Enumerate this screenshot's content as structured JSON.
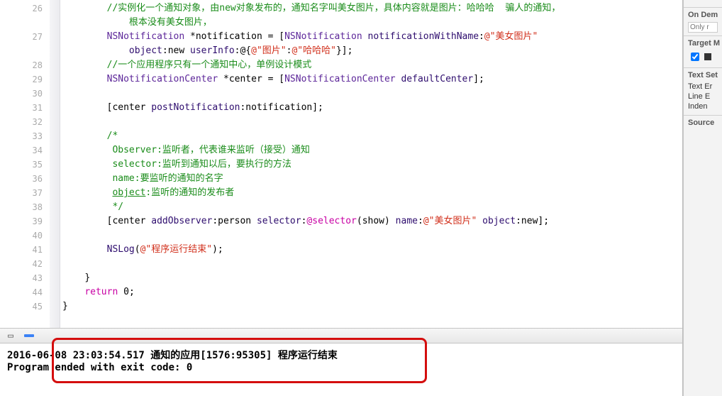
{
  "code": {
    "lines": [
      {
        "n": 26,
        "indent": "        ",
        "tokens": [
          {
            "t": "//实例化一个通知对象，由new对象发布的，通知名字叫美女图片，具体内容就是图片：哈哈哈  骗人的通知，",
            "cls": "c-comment"
          }
        ]
      },
      {
        "n": "",
        "indent": "            ",
        "tokens": [
          {
            "t": "根本没有美女图片，",
            "cls": "c-comment"
          }
        ]
      },
      {
        "n": 27,
        "indent": "        ",
        "tokens": [
          {
            "t": "NSNotification",
            "cls": "c-type"
          },
          {
            "t": " *notification = ["
          },
          {
            "t": "NSNotification",
            "cls": "c-type"
          },
          {
            "t": " "
          },
          {
            "t": "notificationWithName",
            "cls": "c-method"
          },
          {
            "t": ":"
          },
          {
            "t": "@\"美女图片\"",
            "cls": "c-string"
          }
        ]
      },
      {
        "n": "",
        "indent": "            ",
        "tokens": [
          {
            "t": "object",
            "cls": "c-method"
          },
          {
            "t": ":new "
          },
          {
            "t": "userInfo",
            "cls": "c-method"
          },
          {
            "t": ":@{"
          },
          {
            "t": "@\"图片\"",
            "cls": "c-string"
          },
          {
            "t": ":"
          },
          {
            "t": "@\"哈哈哈\"",
            "cls": "c-string"
          },
          {
            "t": "}];"
          }
        ]
      },
      {
        "n": 28,
        "indent": "        ",
        "tokens": [
          {
            "t": "//一个应用程序只有一个通知中心，单例设计模式",
            "cls": "c-comment"
          }
        ]
      },
      {
        "n": 29,
        "indent": "        ",
        "tokens": [
          {
            "t": "NSNotificationCenter",
            "cls": "c-type"
          },
          {
            "t": " *center = ["
          },
          {
            "t": "NSNotificationCenter",
            "cls": "c-type"
          },
          {
            "t": " "
          },
          {
            "t": "defaultCenter",
            "cls": "c-method"
          },
          {
            "t": "];"
          }
        ]
      },
      {
        "n": 30,
        "indent": "        ",
        "tokens": []
      },
      {
        "n": 31,
        "indent": "        ",
        "tokens": [
          {
            "t": "[center "
          },
          {
            "t": "postNotification",
            "cls": "c-method"
          },
          {
            "t": ":notification];"
          }
        ]
      },
      {
        "n": 32,
        "indent": "        ",
        "tokens": []
      },
      {
        "n": 33,
        "indent": "        ",
        "tokens": [
          {
            "t": "/*",
            "cls": "c-comment"
          }
        ]
      },
      {
        "n": 34,
        "indent": "         ",
        "tokens": [
          {
            "t": "Observer:监听者，代表谁来监听（接受）通知",
            "cls": "c-comment"
          }
        ]
      },
      {
        "n": 35,
        "indent": "         ",
        "tokens": [
          {
            "t": "selector:监听到通知以后，要执行的方法",
            "cls": "c-comment"
          }
        ]
      },
      {
        "n": 36,
        "indent": "         ",
        "tokens": [
          {
            "t": "name:要监听的通知的名字",
            "cls": "c-comment"
          }
        ]
      },
      {
        "n": 37,
        "indent": "         ",
        "tokens": [
          {
            "t": "object",
            "cls": "c-comment c-underline"
          },
          {
            "t": ":监听的通知的发布者",
            "cls": "c-comment"
          }
        ]
      },
      {
        "n": 38,
        "indent": "         ",
        "tokens": [
          {
            "t": "*/",
            "cls": "c-comment"
          }
        ]
      },
      {
        "n": 39,
        "indent": "        ",
        "tokens": [
          {
            "t": "[center "
          },
          {
            "t": "addObserver",
            "cls": "c-method"
          },
          {
            "t": ":person "
          },
          {
            "t": "selector",
            "cls": "c-method"
          },
          {
            "t": ":"
          },
          {
            "t": "@selector",
            "cls": "c-preproc"
          },
          {
            "t": "(show) "
          },
          {
            "t": "name",
            "cls": "c-method"
          },
          {
            "t": ":"
          },
          {
            "t": "@\"美女图片\"",
            "cls": "c-string"
          },
          {
            "t": " "
          },
          {
            "t": "object",
            "cls": "c-method"
          },
          {
            "t": ":new];"
          }
        ]
      },
      {
        "n": 40,
        "indent": "        ",
        "tokens": []
      },
      {
        "n": 41,
        "indent": "        ",
        "tokens": [
          {
            "t": "NSLog",
            "cls": "c-func"
          },
          {
            "t": "("
          },
          {
            "t": "@\"程序运行结束\"",
            "cls": "c-string"
          },
          {
            "t": ");"
          }
        ]
      },
      {
        "n": 42,
        "indent": "        ",
        "tokens": []
      },
      {
        "n": 43,
        "indent": "    ",
        "tokens": [
          {
            "t": "}"
          }
        ]
      },
      {
        "n": 44,
        "indent": "    ",
        "tokens": [
          {
            "t": "return",
            "cls": "c-preproc"
          },
          {
            "t": " "
          },
          {
            "t": "0",
            "cls": "c-plain"
          },
          {
            "t": ";"
          }
        ]
      },
      {
        "n": 45,
        "indent": "",
        "tokens": [
          {
            "t": "}"
          }
        ]
      }
    ]
  },
  "console": {
    "line1": "2016-06-08 23:03:54.517 通知的应用[1576:95305] 程序运行结束",
    "line2": "Program ended with exit code: 0"
  },
  "sidebar": {
    "on_demand": {
      "title": "On Dem",
      "placeholder": "Only r"
    },
    "target": {
      "title": "Target M",
      "item": ""
    },
    "text": {
      "title": "Text Set",
      "l1": "Text Er",
      "l2": "Line E",
      "l3": "Inden"
    },
    "source": {
      "title": "Source "
    }
  }
}
